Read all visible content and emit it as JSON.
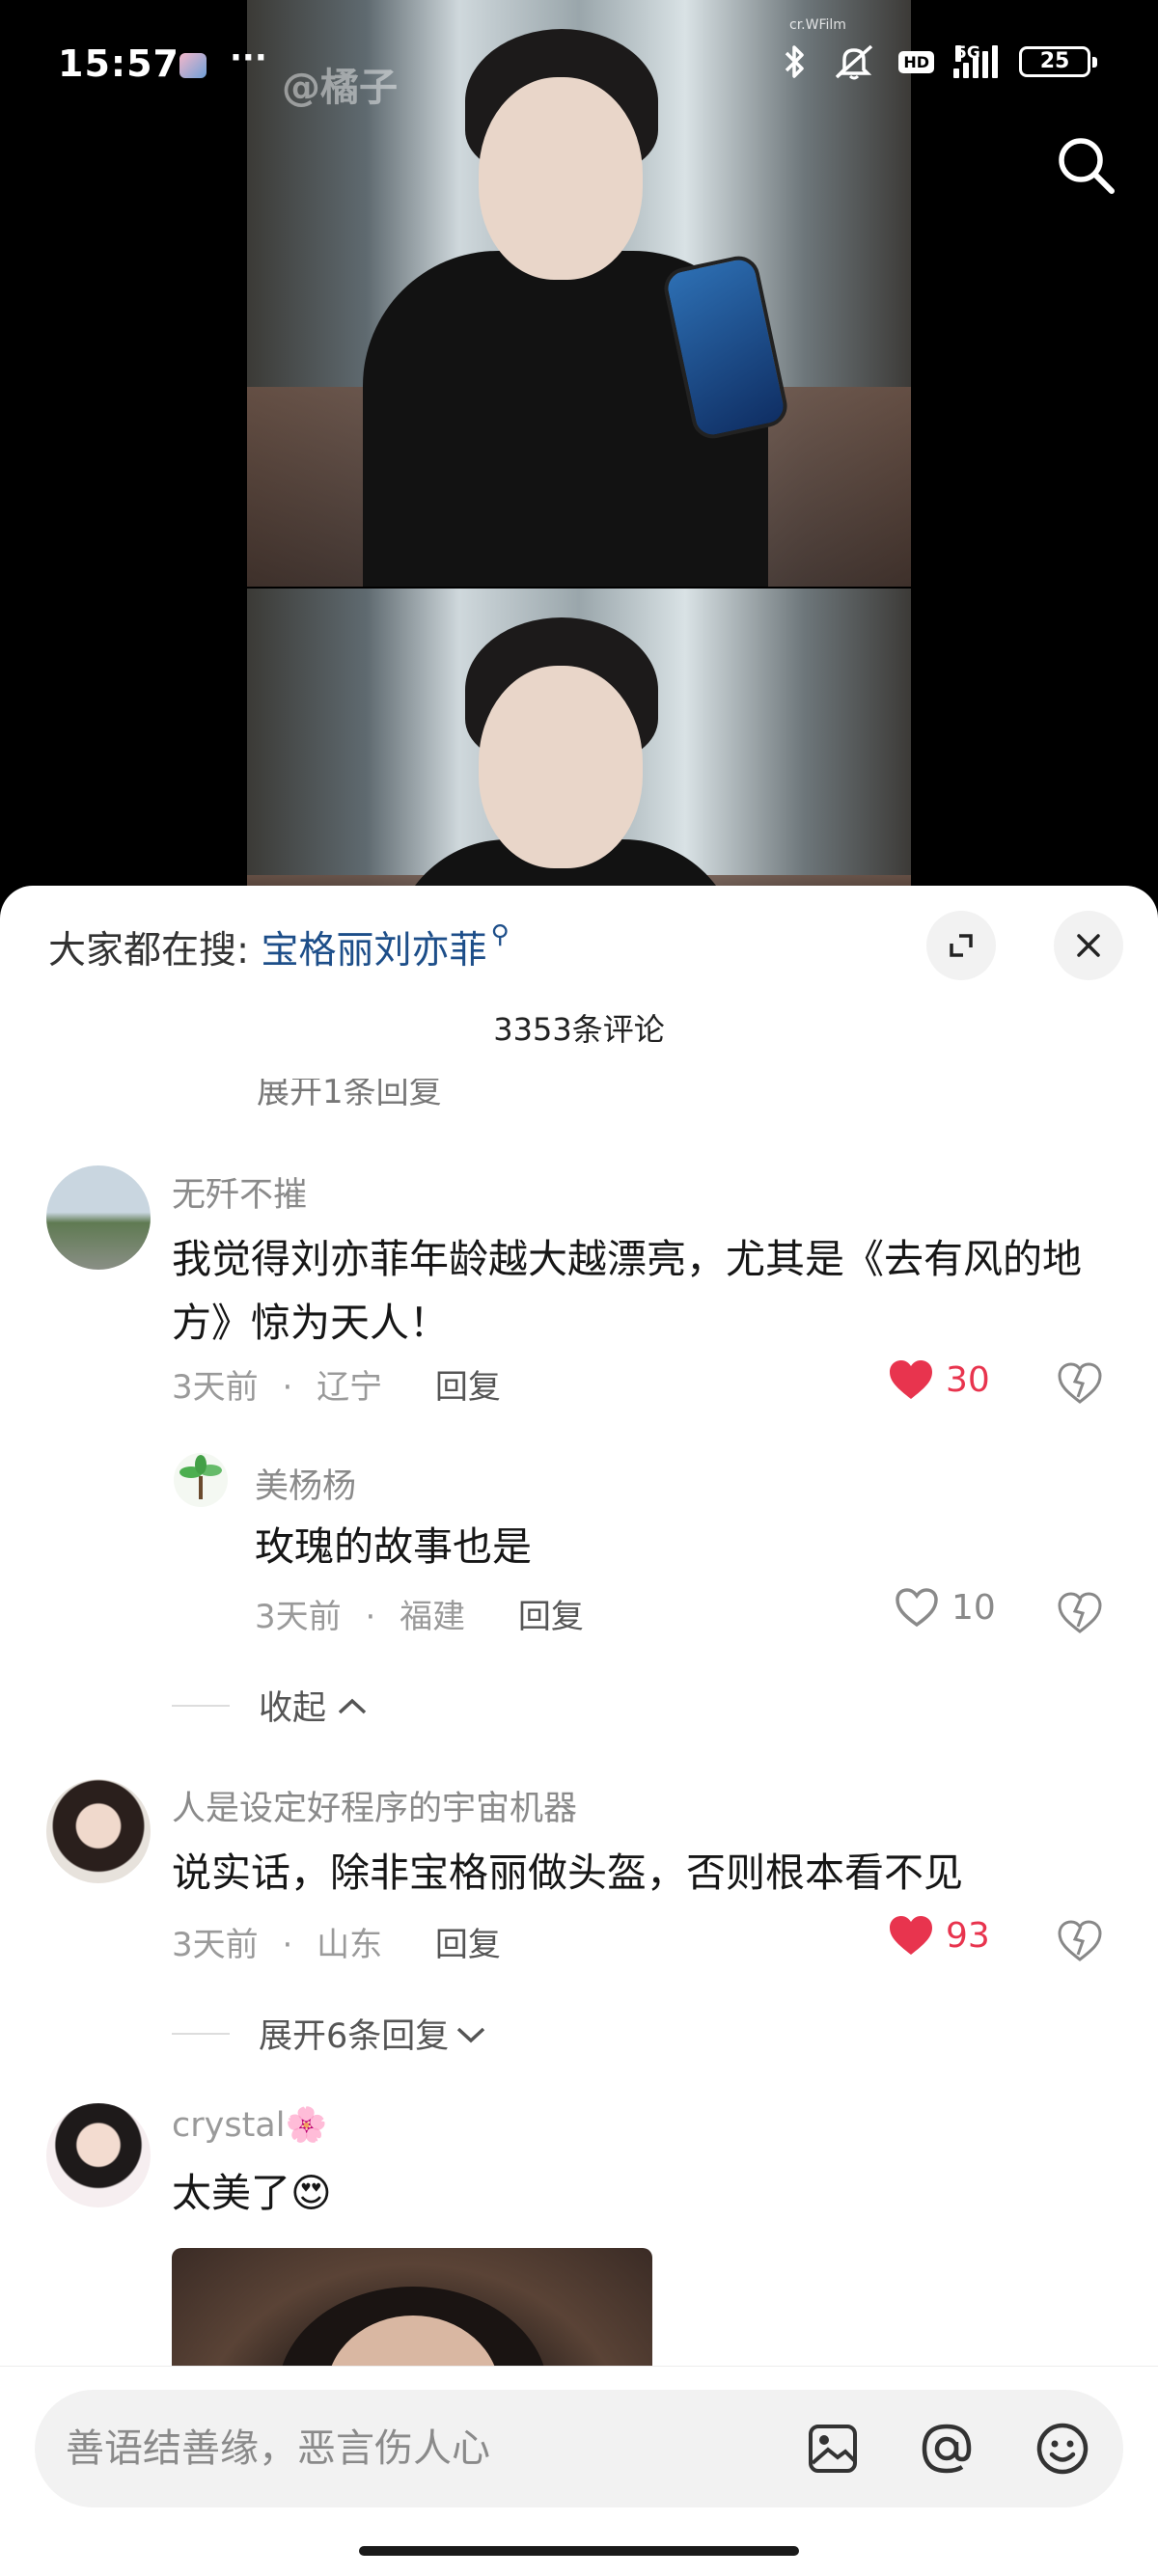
{
  "status_bar": {
    "time": "15:57",
    "dots": "···",
    "network": "5G",
    "hd": "HD",
    "battery": "25"
  },
  "video": {
    "watermark": "@橘子",
    "watermark_small": "cr.WFilm"
  },
  "sheet": {
    "hot_search_label": "大家都在搜:",
    "hot_search_keyword": "宝格丽刘亦菲",
    "comment_count": "3353条评论",
    "cut_text": "展开1条回复"
  },
  "comments": [
    {
      "user": "无歼不摧",
      "text": "我觉得刘亦菲年龄越大越漂亮，尤其是《去有风的地方》惊为天人！",
      "time": "3天前",
      "location": "辽宁",
      "reply": "回复",
      "likes": "30",
      "liked": true
    },
    {
      "user": "美杨杨",
      "text": "玫瑰的故事也是",
      "time": "3天前",
      "location": "福建",
      "reply": "回复",
      "likes": "10",
      "liked": false
    },
    {
      "user": "人是设定好程序的宇宙机器",
      "text": "说实话，除非宝格丽做头盔，否则根本看不见",
      "time": "3天前",
      "location": "山东",
      "reply": "回复",
      "likes": "93",
      "liked": true
    },
    {
      "user": "crystal🌸",
      "text": "太美了😍"
    }
  ],
  "toggles": {
    "collapse": "收起",
    "expand": "展开6条回复"
  },
  "separator": "·",
  "input": {
    "placeholder": "善语结善缘，恶言伤人心"
  },
  "colors": {
    "like_red": "#e8344e",
    "keyword_blue": "#1d4e89"
  },
  "icons": [
    "search-icon",
    "expand-icon",
    "close-icon",
    "heart-icon",
    "dislike-icon",
    "image-icon",
    "at-icon",
    "emoji-icon"
  ]
}
